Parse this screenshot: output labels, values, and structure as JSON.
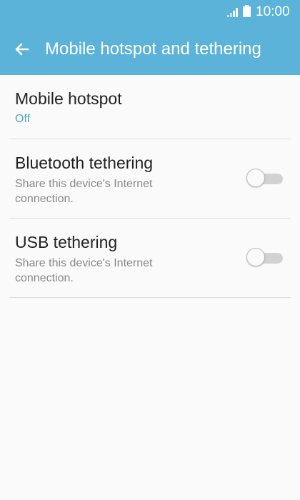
{
  "status_bar": {
    "time": "10:00",
    "icons": [
      "signal-icon",
      "battery-icon"
    ]
  },
  "header": {
    "title": "Mobile hotspot and tethering",
    "back_icon": "arrow-left-icon"
  },
  "settings": [
    {
      "title": "Mobile hotspot",
      "status": "Off"
    },
    {
      "title": "Bluetooth tethering",
      "summary": "Share this device's Internet connection.",
      "enabled": false
    },
    {
      "title": "USB tethering",
      "summary": "Share this device's Internet connection.",
      "enabled": false
    }
  ],
  "colors": {
    "appbar": "#5bb3d9",
    "accent_text": "#4aa9c7",
    "background": "#fafafa",
    "divider": "#e0e0e0"
  }
}
